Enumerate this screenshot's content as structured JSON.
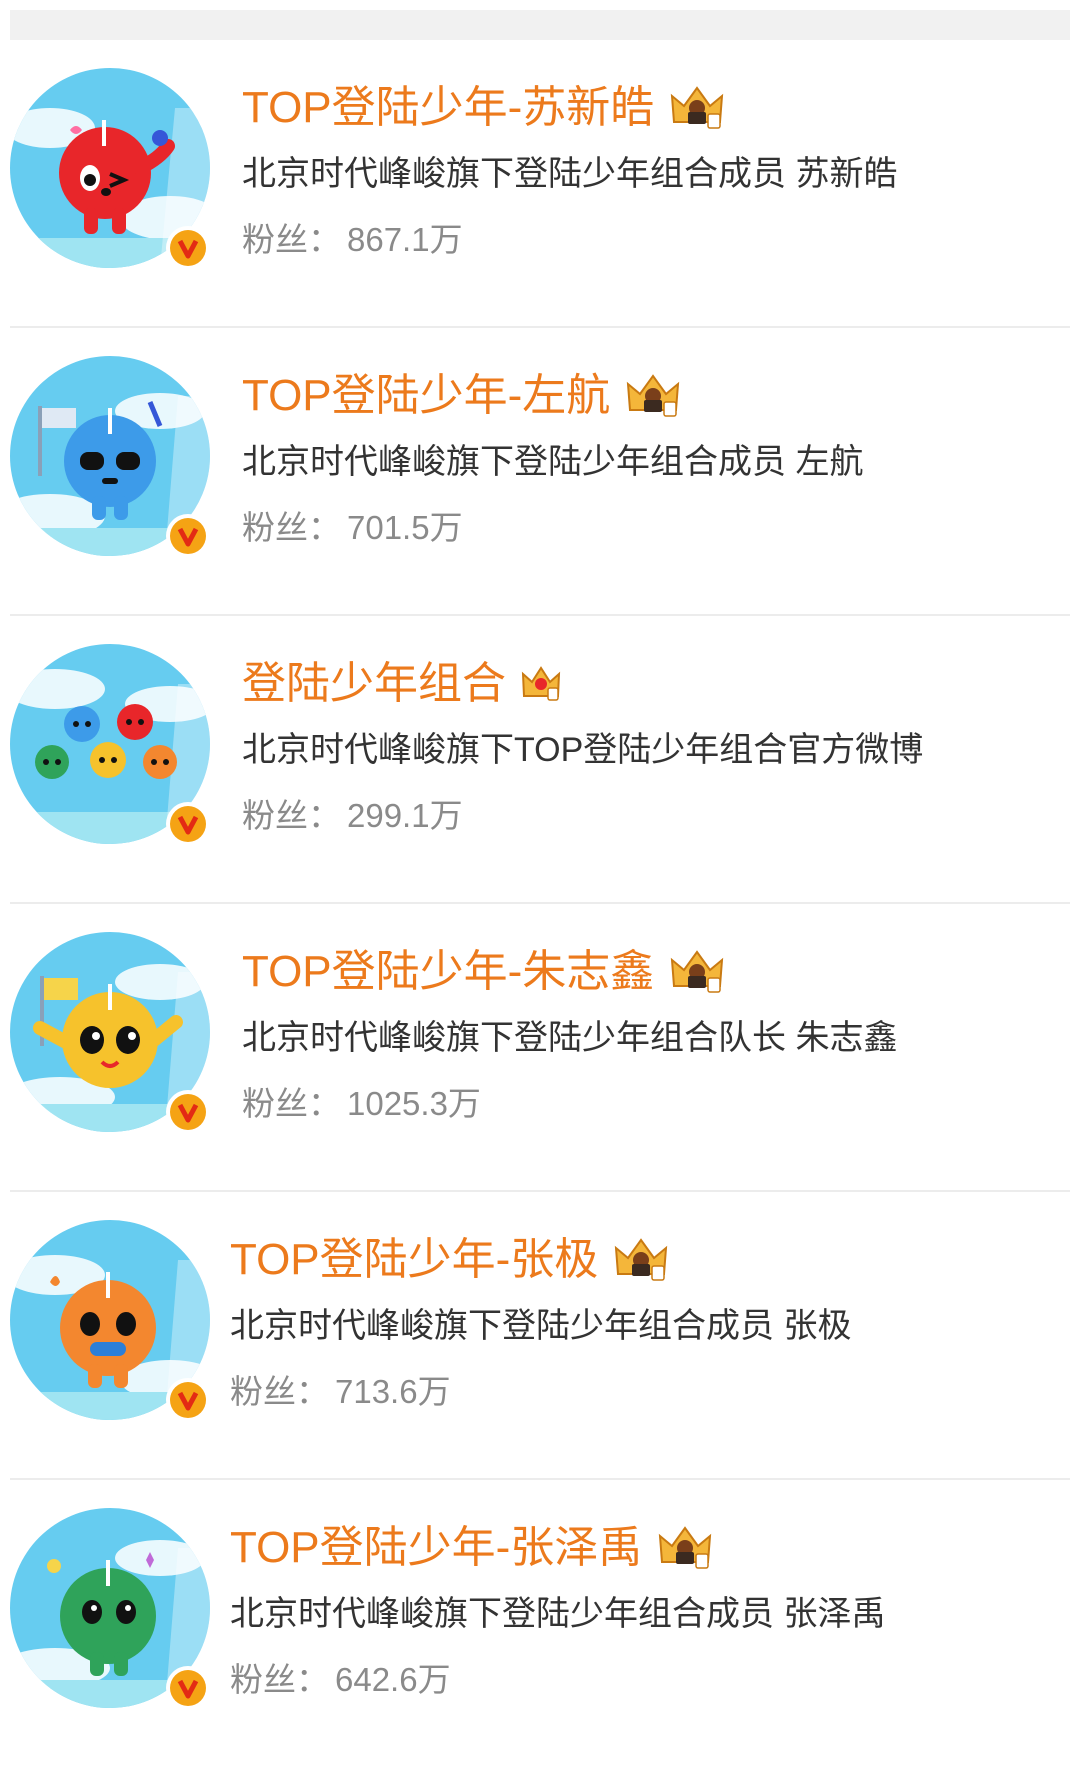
{
  "accounts": [
    {
      "name": "TOP登陆少年-苏新皓",
      "description": "北京时代峰峻旗下登陆少年组合成员 苏新皓",
      "fans_label": "粉丝：",
      "fans_value": "867.1万",
      "avatar_color": "#e8262a",
      "avatar_icon": "red-coconut-mascot-icon",
      "verified": true
    },
    {
      "name": "TOP登陆少年-左航",
      "description": "北京时代峰峻旗下登陆少年组合成员 左航",
      "fans_label": "粉丝：",
      "fans_value": "701.5万",
      "avatar_color": "#3d9be9",
      "avatar_icon": "blue-coconut-mascot-icon",
      "verified": true
    },
    {
      "name": "登陆少年组合",
      "description": "北京时代峰峻旗下TOP登陆少年组合官方微博",
      "fans_label": "粉丝：",
      "fans_value": "299.1万",
      "avatar_color": "#f3c531",
      "avatar_icon": "group-mascots-icon",
      "verified": true
    },
    {
      "name": "TOP登陆少年-朱志鑫",
      "description": "北京时代峰峻旗下登陆少年组合队长 朱志鑫",
      "fans_label": "粉丝：",
      "fans_value": "1025.3万",
      "avatar_color": "#f6c22c",
      "avatar_icon": "yellow-coconut-mascot-icon",
      "verified": true
    },
    {
      "name": "TOP登陆少年-张极",
      "description": "北京时代峰峻旗下登陆少年组合成员 张极",
      "fans_label": "粉丝：",
      "fans_value": "713.6万",
      "avatar_color": "#f3872f",
      "avatar_icon": "orange-coconut-mascot-icon",
      "verified": true
    },
    {
      "name": "TOP登陆少年-张泽禹",
      "description": "北京时代峰峻旗下登陆少年组合成员 张泽禹",
      "fans_label": "粉丝：",
      "fans_value": "642.6万",
      "avatar_color": "#2fa35a",
      "avatar_icon": "green-coconut-mascot-icon",
      "verified": true
    }
  ],
  "colors": {
    "name": "#ec7a1c",
    "description": "#333333",
    "fans": "#8a8a8a",
    "verified_badge": "#f5a314",
    "sky": "#5cc8ee"
  }
}
